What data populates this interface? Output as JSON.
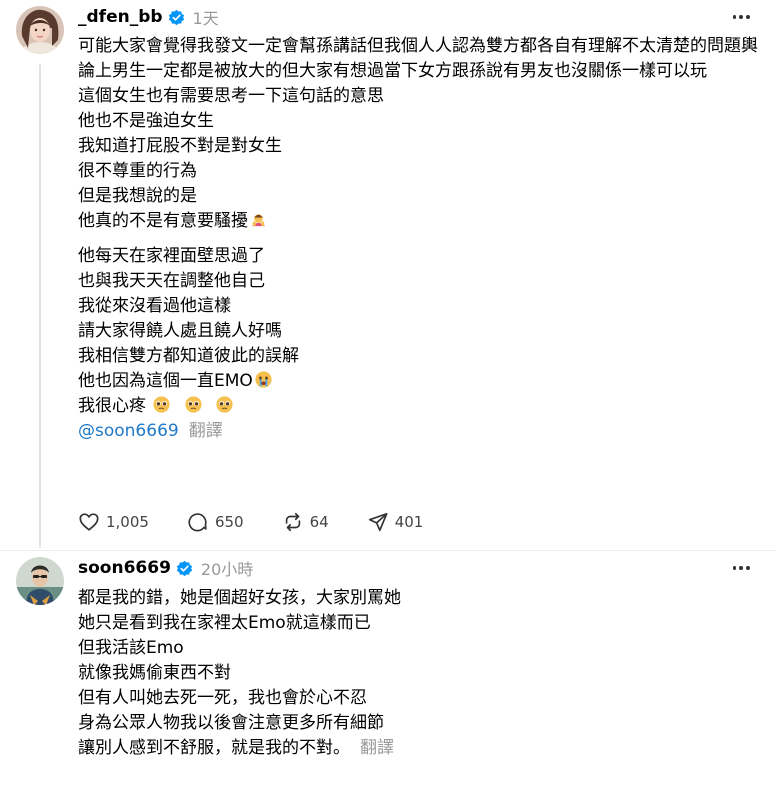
{
  "post1": {
    "username": "_dfen_bb",
    "time": "1天",
    "para_lines": [
      "可能大家會覺得我發文一定會幫孫講話但我個人人認為雙方都各自有理解不太清楚的問題輿論上男生一定都是被放大的但大家有想過當下女方跟孫說有男友也沒關係一樣可以玩",
      "這個女生也有需要思考一下這句話的意思",
      "他也不是強迫女生",
      "我知道打屁股不對是對女生",
      "很不尊重的行為",
      "但是我想說的是",
      "他真的不是有意要騷擾"
    ],
    "para2_lines": [
      "他每天在家裡面壁思過了",
      "也與我天天在調整他自己",
      "我從來沒看過他這樣",
      "請大家得饒人處且饒人好嗎",
      "我相信雙方都知道彼此的誤解",
      "他也因為這個一直EMO",
      "我很心疼"
    ],
    "mention": "@soon6669",
    "translate": "翻譯",
    "likes": "1,005",
    "comments": "650",
    "reposts": "64",
    "shares": "401"
  },
  "post2": {
    "username": "soon6669",
    "time": "20小時",
    "lines": [
      "都是我的錯，她是個超好女孩，大家別罵她",
      "她只是看到我在家裡太Emo就這樣而已",
      "但我活該Emo",
      "就像我媽偷東西不對",
      "但有人叫她去死一死，我也會於心不忍",
      "身為公眾人物我以後會注意更多所有細節",
      "讓別人感到不舒服，就是我的不對。"
    ],
    "translate": "翻譯"
  },
  "icons": {
    "like": "heart-icon",
    "comment": "comment-icon",
    "repost": "repost-icon",
    "share": "share-icon",
    "verified": "verified-badge-icon",
    "more": "more-icon"
  },
  "colors": {
    "link": "#1f78c8",
    "muted": "#999999",
    "verified": "#0095f6"
  }
}
